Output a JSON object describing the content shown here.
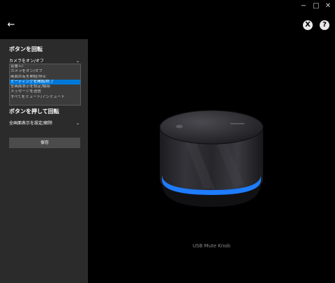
{
  "window": {
    "minimize": "−",
    "maximize": "□",
    "close": "✕"
  },
  "nav": {
    "back_glyph": "←"
  },
  "header": {
    "xbox_glyph": "X",
    "help_glyph": "?"
  },
  "sidebar": {
    "rotate_title": "ボタンを回転",
    "rotate_selected": "カメラをオン/オフ",
    "options": [
      "音量+/-",
      "カメラをオン/オフ",
      "画面共有を開始/停止",
      "ミーティングを開始/終了",
      "全画面表示を設定/解除",
      "メッセージを送信",
      "すべてをミュート/アンミュート"
    ],
    "highlighted_index": 3,
    "press_title": "ボタンを押して回転",
    "press_selected": "全画面表示を設定/解除",
    "save_label": "保存"
  },
  "device": {
    "caption": "USB Mute Knob",
    "ring_color": "#1e7cff"
  },
  "icons": {
    "back": "back-arrow-icon",
    "xbox": "xbox-icon",
    "help": "help-icon",
    "chevron": "chevron-down-icon"
  }
}
